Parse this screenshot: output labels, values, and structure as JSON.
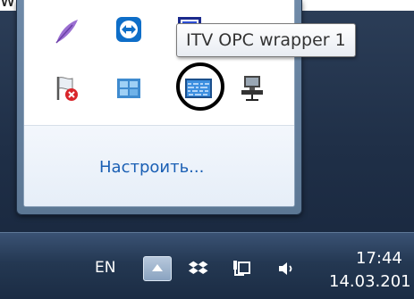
{
  "page": {
    "top_text": "windows."
  },
  "popup": {
    "customize_label": "Настроить...",
    "icons": [
      {
        "name": "feather-icon"
      },
      {
        "name": "teamviewer-icon"
      },
      {
        "name": "blue-square-app-icon"
      },
      {
        "name": "flag-error-icon"
      },
      {
        "name": "grid-app-icon"
      },
      {
        "name": "itv-opc-wrapper-icon"
      },
      {
        "name": "network-computer-icon"
      }
    ]
  },
  "tooltip": {
    "text": "ITV OPC wrapper 1"
  },
  "taskbar": {
    "language": "EN",
    "time": "17:44",
    "date": "14.03.201"
  },
  "colors": {
    "taskbar": "#243852",
    "popup_frame": "#6f8aa8",
    "link": "#1a5fb4",
    "highlight_circle": "#000000"
  }
}
